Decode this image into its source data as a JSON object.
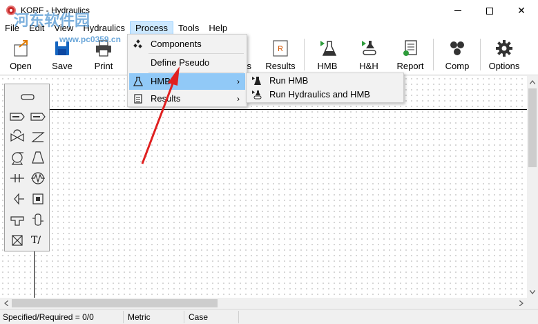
{
  "window": {
    "title": "KORF - Hydraulics",
    "watermark": "河东软件园",
    "watermark_url": "www.pc0359.cn"
  },
  "menubar": {
    "items": [
      {
        "label": "File"
      },
      {
        "label": "Edit"
      },
      {
        "label": "View"
      },
      {
        "label": "Hydraulics"
      },
      {
        "label": "Process",
        "active": true
      },
      {
        "label": "Tools"
      },
      {
        "label": "Help"
      }
    ]
  },
  "toolbar": {
    "open": "Open",
    "save": "Save",
    "print": "Print",
    "results": "Results",
    "hmb": "HMB",
    "hh": "H&H",
    "report": "Report",
    "comp": "Comp",
    "options": "Options",
    "partial_label": "s",
    "results_badge": "R"
  },
  "process_menu": {
    "items": [
      {
        "label": "Components",
        "icon": "components-icon"
      },
      {
        "label": "Define Pseudo",
        "icon": ""
      },
      {
        "label": "HMB",
        "icon": "flask-icon",
        "highlighted": true,
        "has_submenu": true
      },
      {
        "label": "Results",
        "icon": "results-doc-icon",
        "has_submenu": true
      }
    ]
  },
  "hmb_submenu": {
    "items": [
      {
        "label": "Run HMB",
        "icon": "run-flask-icon"
      },
      {
        "label": "Run Hydraulics and HMB",
        "icon": "run-hh-icon"
      }
    ]
  },
  "palette": {
    "text_tool": "T/"
  },
  "statusbar": {
    "specified": "Specified/Required = 0/0",
    "units": "Metric",
    "case": "Case"
  },
  "colors": {
    "menu_highlight": "#91c9f7",
    "menubar_active": "#cce8ff",
    "annotation_arrow": "#e02020",
    "toolbar_green": "#2e9c3b",
    "app_icon": "#c62828"
  }
}
